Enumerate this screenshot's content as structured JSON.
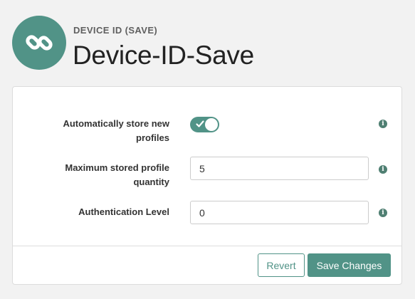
{
  "header": {
    "subtitle": "DEVICE ID (SAVE)",
    "title": "Device-ID-Save",
    "logo_icon": "link-icon"
  },
  "form": {
    "auto_store": {
      "label": "Automatically store new profiles",
      "enabled": true
    },
    "max_profiles": {
      "label": "Maximum stored profile quantity",
      "value": "5"
    },
    "auth_level": {
      "label": "Authentication Level",
      "value": "0"
    },
    "info_glyph": "i"
  },
  "actions": {
    "revert_label": "Revert",
    "save_label": "Save Changes"
  },
  "colors": {
    "accent": "#519387",
    "info": "#4f7f72",
    "background": "#f2f2f2"
  }
}
